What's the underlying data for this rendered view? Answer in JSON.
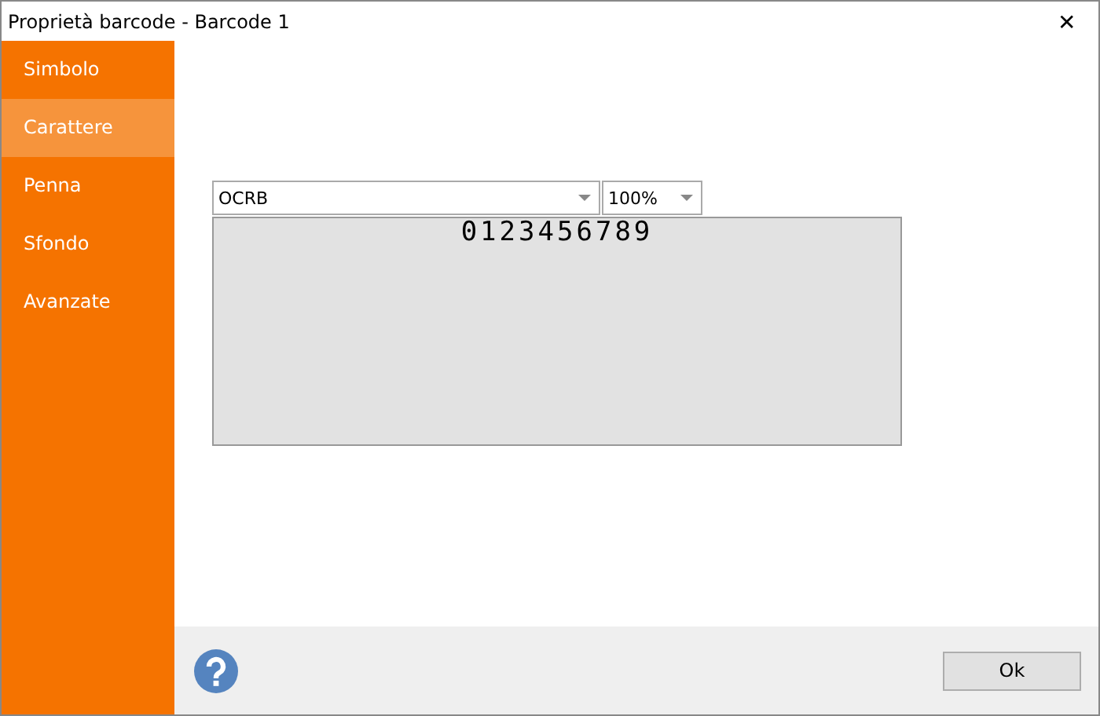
{
  "window": {
    "title": "Proprietà barcode - Barcode 1",
    "close": "✕"
  },
  "sidebar": {
    "items": [
      {
        "label": "Simbolo",
        "selected": false
      },
      {
        "label": "Carattere",
        "selected": true
      },
      {
        "label": "Penna",
        "selected": false
      },
      {
        "label": "Sfondo",
        "selected": false
      },
      {
        "label": "Avanzate",
        "selected": false
      }
    ]
  },
  "font": {
    "value": "OCRB"
  },
  "size": {
    "value": "100%"
  },
  "preview": {
    "text": "0123456789"
  },
  "buttons": [
    "Ok"
  ]
}
